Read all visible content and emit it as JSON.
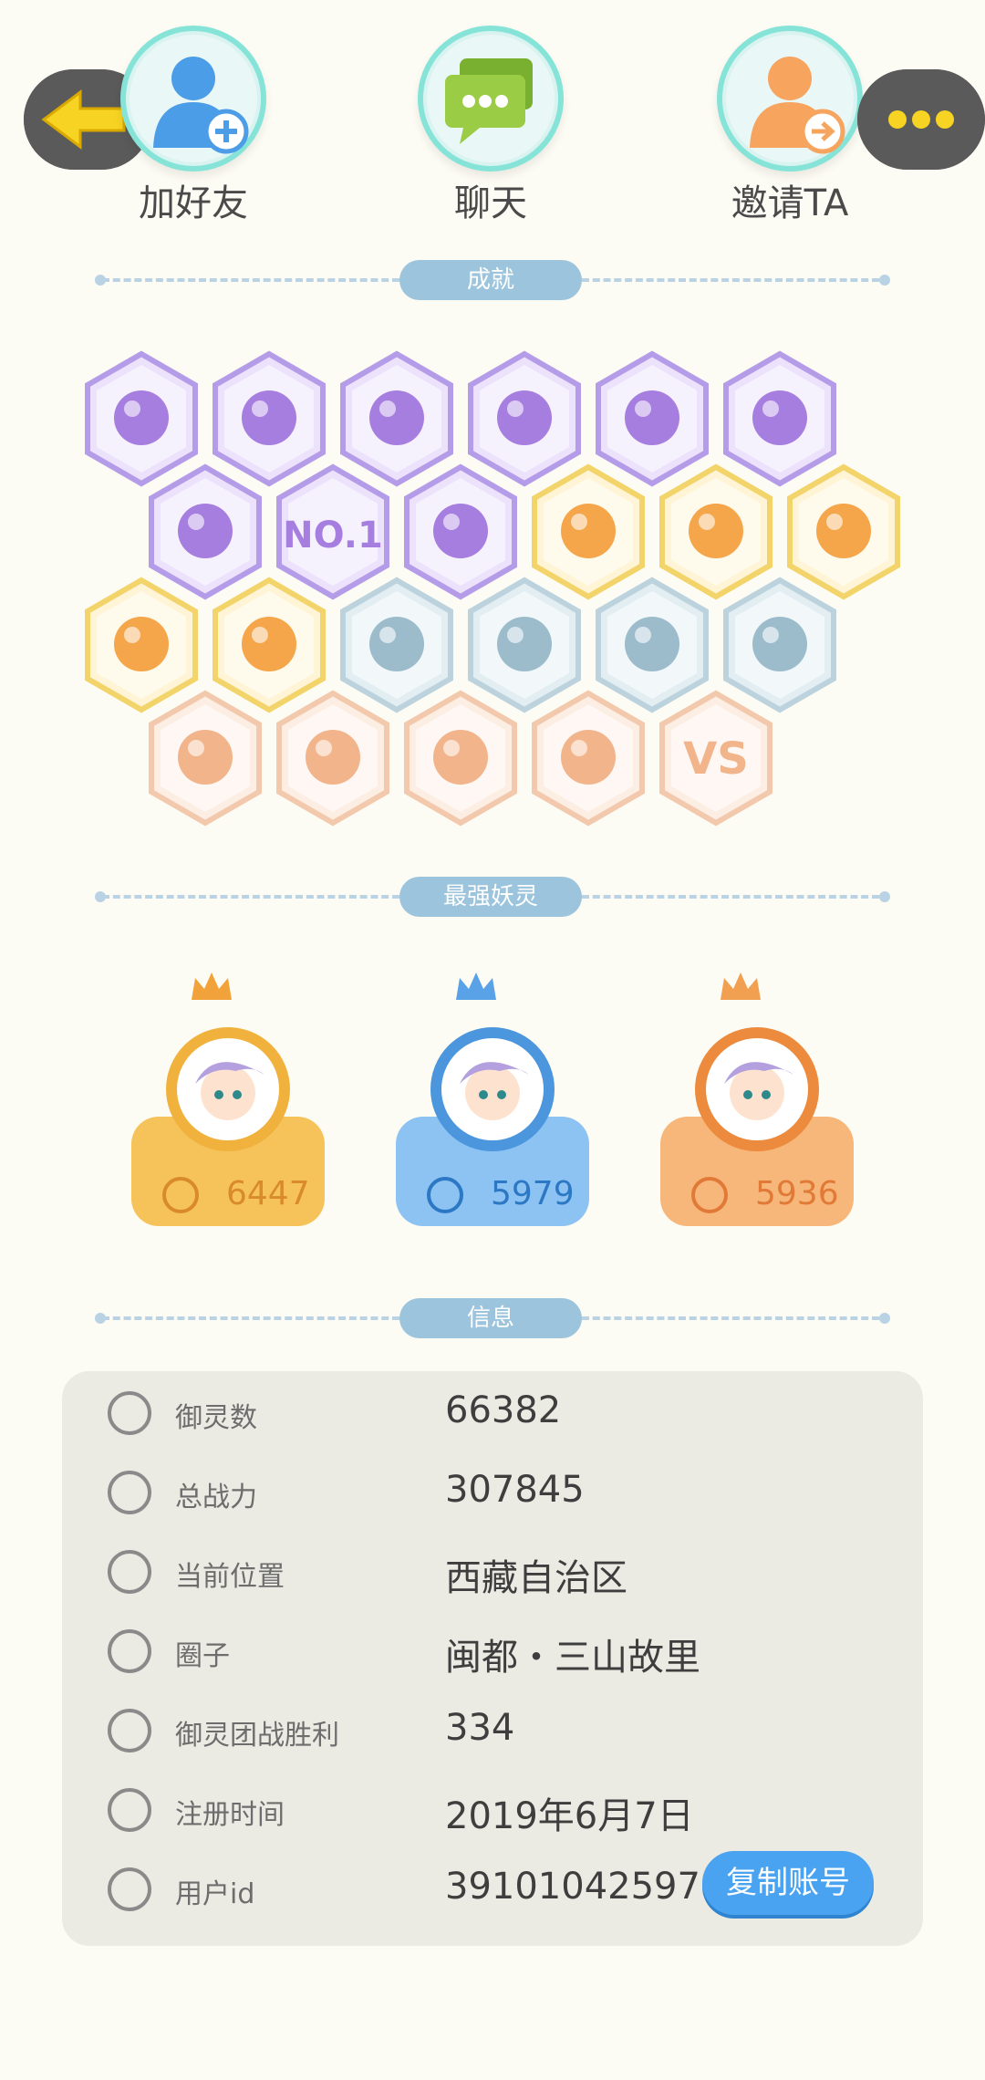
{
  "actions": {
    "add_friend": "加好友",
    "chat": "聊天",
    "invite": "邀请TA"
  },
  "sections": {
    "achievements": "成就",
    "strongest": "最强妖灵",
    "info": "信息"
  },
  "badges": {
    "row1": [
      "sneaker-badge",
      "lollipop-badge",
      "demon-badge",
      "gem-badge",
      "yin-yang-spirit-badge",
      "cat-spirit-badge"
    ],
    "row2": [
      "fish-badge",
      "no1-badge",
      "angry-bun-badge",
      "sun-moon-badge",
      "egg-badge",
      "fire-spirit-badge"
    ],
    "row3": [
      "taiji-badge",
      "shield-badge",
      "frozen-beast-badge",
      "frozen-spirit-badge",
      "frozen-belt-badge",
      "crossed-swords-badge"
    ],
    "row4": [
      "stroller-badge",
      "book-badge",
      "couple-badge",
      "pet-badge",
      "vs-badge"
    ],
    "no1_text": "NO.1",
    "vs_text": "VS"
  },
  "top_spirits": [
    {
      "power": "6447",
      "color": "#f6c25a"
    },
    {
      "power": "5979",
      "color": "#8cc3f2"
    },
    {
      "power": "5936",
      "color": "#f7b67a"
    }
  ],
  "info": {
    "rows": [
      {
        "label": "御灵数",
        "value": "66382"
      },
      {
        "label": "总战力",
        "value": "307845"
      },
      {
        "label": "当前位置",
        "value": "西藏自治区"
      },
      {
        "label": "圈子",
        "value": "闽都・三山故里"
      },
      {
        "label": "御灵团战胜利",
        "value": "334"
      },
      {
        "label": "注册时间",
        "value": "2019年6月7日"
      },
      {
        "label": "用户id",
        "value": "39101042597"
      }
    ],
    "copy_button": "复制账号"
  }
}
